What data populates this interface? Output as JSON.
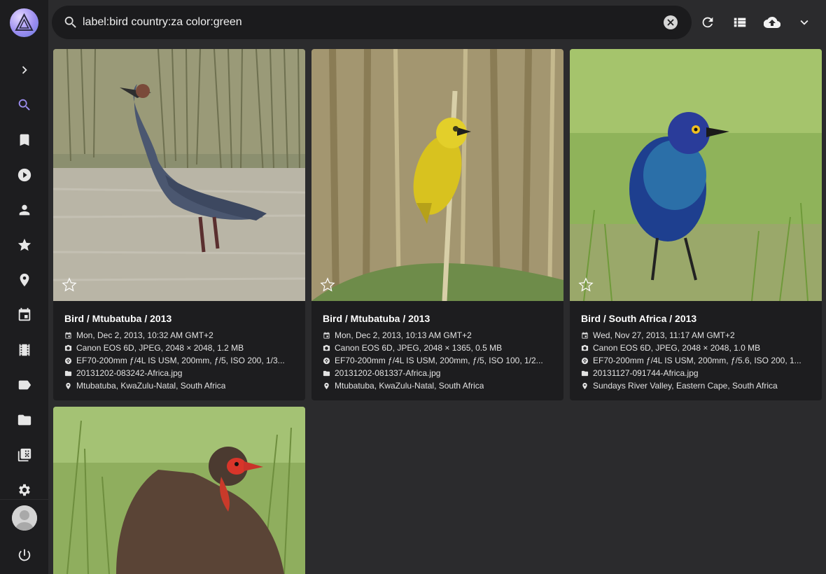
{
  "search": {
    "query": "label:bird country:za color:green"
  },
  "sidebar": {
    "items": [
      {
        "name": "expand",
        "icon": "chevron-right-icon"
      },
      {
        "name": "search",
        "icon": "search-icon",
        "active": true
      },
      {
        "name": "albums",
        "icon": "bookmark-icon"
      },
      {
        "name": "videos",
        "icon": "play-circle-icon"
      },
      {
        "name": "people",
        "icon": "person-icon"
      },
      {
        "name": "favorites",
        "icon": "star-icon"
      },
      {
        "name": "places",
        "icon": "place-icon"
      },
      {
        "name": "calendar",
        "icon": "calendar-icon"
      },
      {
        "name": "moments",
        "icon": "film-icon"
      },
      {
        "name": "labels",
        "icon": "label-icon"
      },
      {
        "name": "folders",
        "icon": "folder-icon"
      },
      {
        "name": "library",
        "icon": "library-icon"
      },
      {
        "name": "settings",
        "icon": "gear-icon"
      },
      {
        "name": "logout",
        "icon": "power-icon"
      }
    ],
    "accent": "#9c8ef0"
  },
  "toolbar": {
    "buttons": [
      "refresh-icon",
      "list-view-icon",
      "upload-cloud-icon",
      "chevron-down-icon"
    ]
  },
  "photos": [
    {
      "title": "Bird / Mtubatuba / 2013",
      "date": "Mon, Dec 2, 2013, 10:32 AM GMT+2",
      "camera": "Canon EOS 6D, JPEG, 2048 × 2048, 1.2 MB",
      "lens": "EF70-200mm ƒ/4L IS USM, 200mm, ƒ/5, ISO 200, 1/3...",
      "file": "20131202-083242-Africa.jpg",
      "location": "Mtubatuba, KwaZulu-Natal, South Africa"
    },
    {
      "title": "Bird / Mtubatuba / 2013",
      "date": "Mon, Dec 2, 2013, 10:13 AM GMT+2",
      "camera": "Canon EOS 6D, JPEG, 2048 × 1365, 0.5 MB",
      "lens": "EF70-200mm ƒ/4L IS USM, 200mm, ƒ/5, ISO 100, 1/2...",
      "file": "20131202-081337-Africa.jpg",
      "location": "Mtubatuba, KwaZulu-Natal, South Africa"
    },
    {
      "title": "Bird / South Africa / 2013",
      "date": "Wed, Nov 27, 2013, 11:17 AM GMT+2",
      "camera": "Canon EOS 6D, JPEG, 2048 × 2048, 1.0 MB",
      "lens": "EF70-200mm ƒ/4L IS USM, 200mm, ƒ/5.6, ISO 200, 1...",
      "file": "20131127-091744-Africa.jpg",
      "location": "Sundays River Valley, Eastern Cape, South Africa"
    }
  ]
}
